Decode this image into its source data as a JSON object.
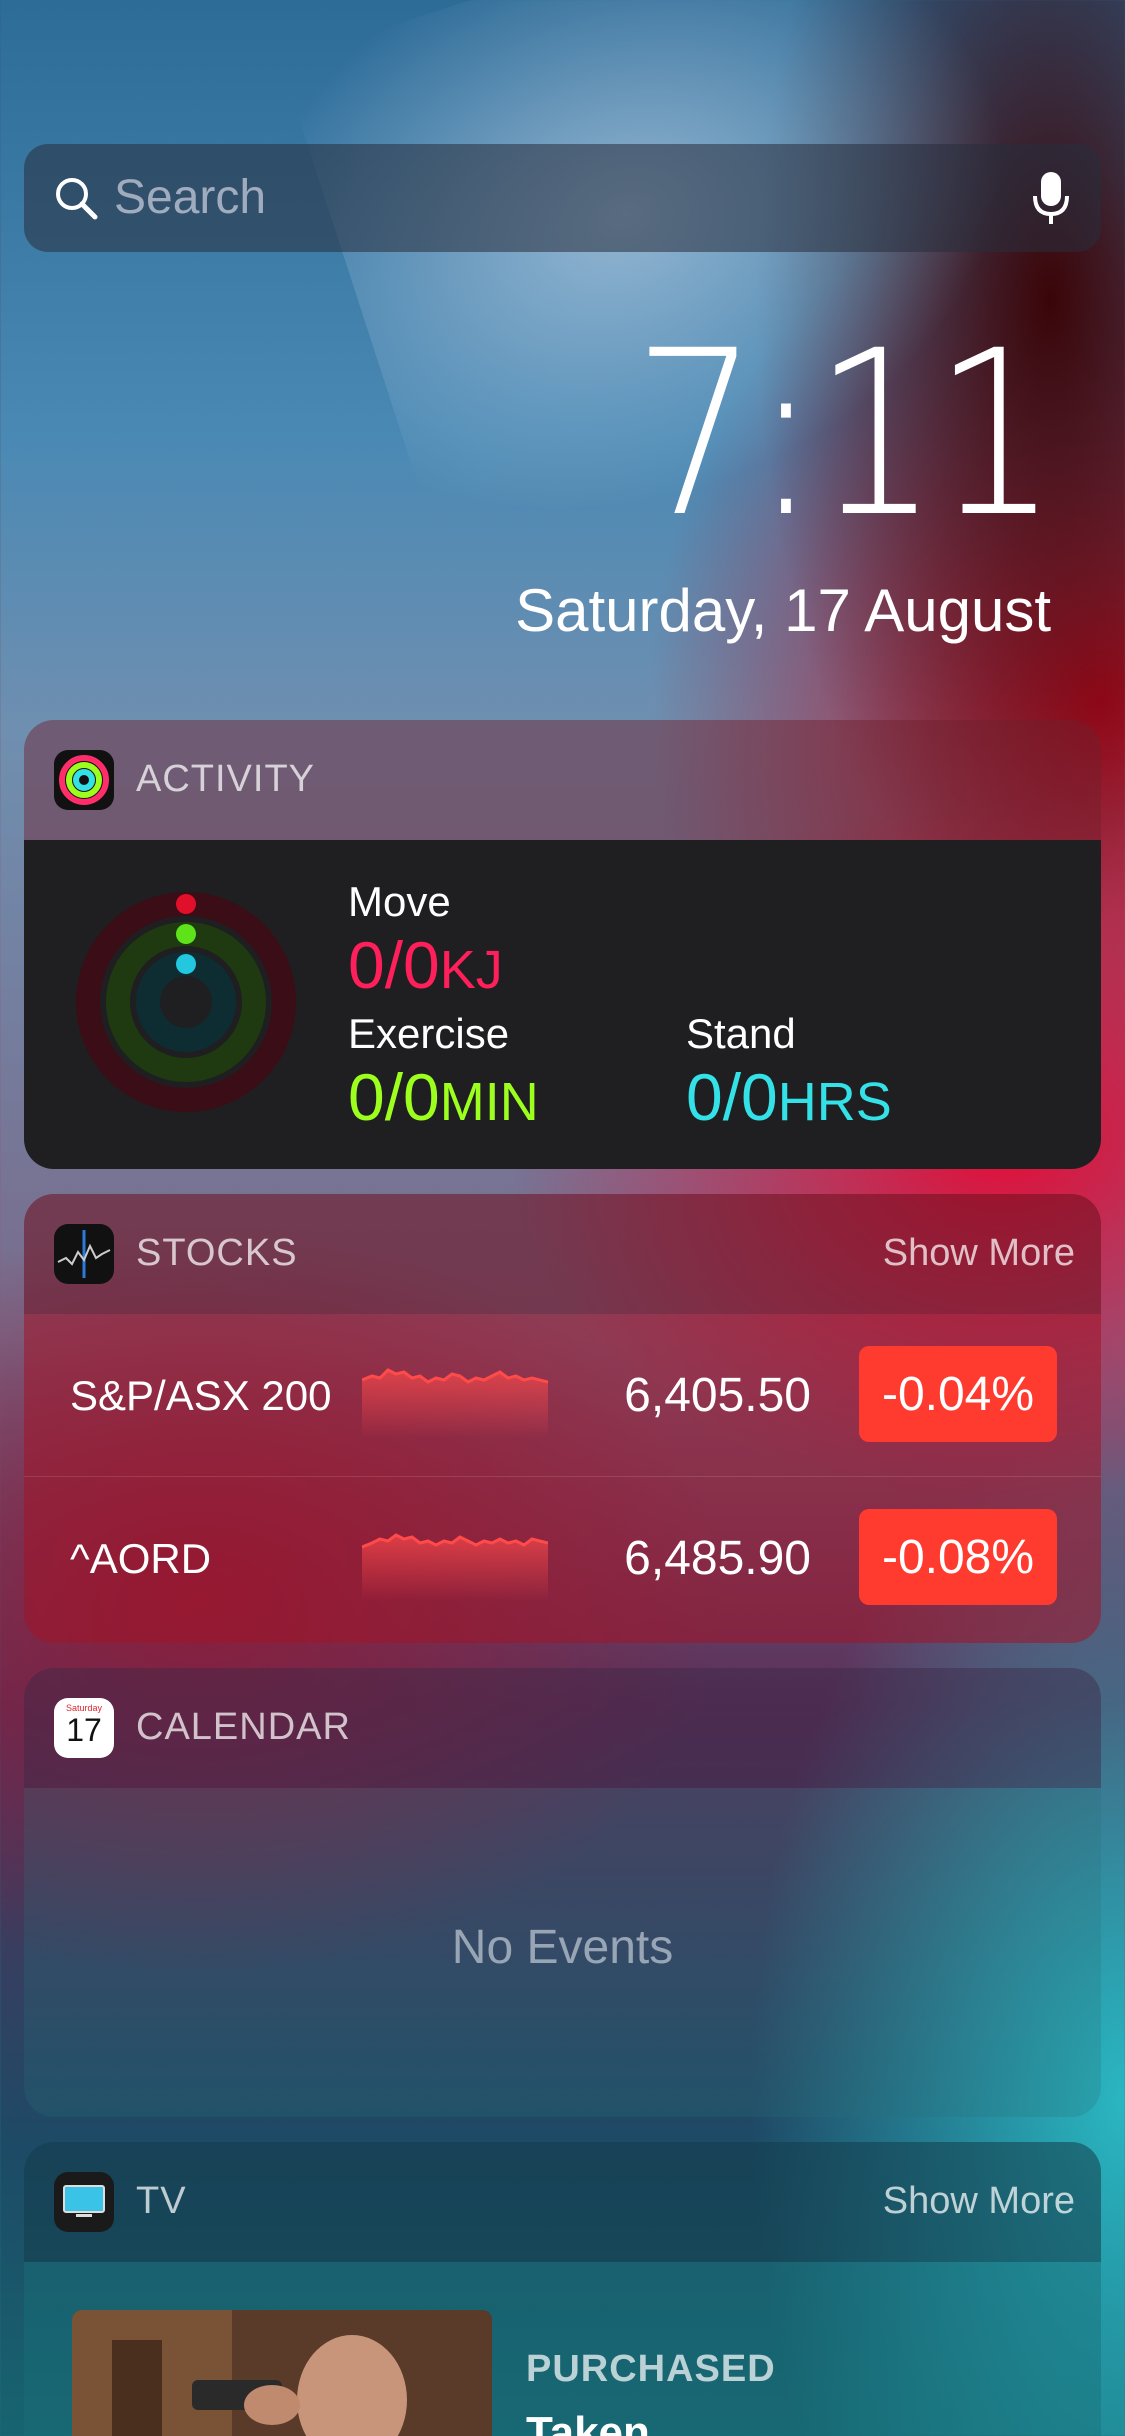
{
  "search": {
    "placeholder": "Search"
  },
  "clock": {
    "time": "7:11",
    "date": "Saturday, 17 August"
  },
  "activity": {
    "title": "ACTIVITY",
    "move": {
      "label": "Move",
      "value": "0/0",
      "unit": "KJ",
      "color": "#ff1f5a"
    },
    "exercise": {
      "label": "Exercise",
      "value": "0/0",
      "unit": "MIN",
      "color": "#9cff1e"
    },
    "stand": {
      "label": "Stand",
      "value": "0/0",
      "unit": "HRS",
      "color": "#33e1e6"
    }
  },
  "stocks": {
    "title": "STOCKS",
    "show_more": "Show More",
    "rows": [
      {
        "name": "S&P/ASX 200",
        "price": "6,405.50",
        "change": "-0.04%"
      },
      {
        "name": "^AORD",
        "price": "6,485.90",
        "change": "-0.08%"
      }
    ]
  },
  "calendar": {
    "title": "CALENDAR",
    "icon_day": "Saturday",
    "icon_date": "17",
    "empty": "No Events"
  },
  "tv": {
    "title": "TV",
    "show_more": "Show More",
    "item": {
      "tag": "PURCHASED",
      "title": "Taken"
    }
  }
}
